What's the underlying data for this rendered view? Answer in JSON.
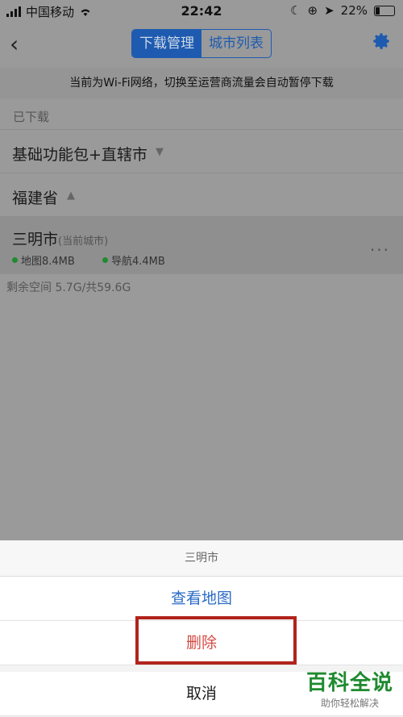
{
  "status_bar": {
    "carrier": "中国移动",
    "time": "22:42",
    "battery": "22%"
  },
  "nav": {
    "tabs": [
      {
        "label": "下载管理",
        "active": true
      },
      {
        "label": "城市列表",
        "active": false
      }
    ],
    "back_icon": "back-chevron-icon",
    "settings_icon": "gear-icon",
    "accent": "#1e5bb0"
  },
  "notice": "当前为Wi-Fi网络，切换至运营商流量会自动暂停下载",
  "downloaded": {
    "section_label": "已下载",
    "groups": [
      {
        "title": "基础功能包+直辖市",
        "expanded": false
      },
      {
        "title": "福建省",
        "expanded": true
      }
    ],
    "city": {
      "name": "三明市",
      "tag": "(当前城市)",
      "map": "地图8.4MB",
      "navigation": "导航4.4MB",
      "more": "···"
    }
  },
  "storage": "剩余空间 5.7G/共59.6G",
  "action_sheet": {
    "title": "三明市",
    "view_map": "查看地图",
    "delete": "删除",
    "cancel": "取消"
  },
  "watermark": {
    "title": "百科全说",
    "subtitle": "助你轻松解决"
  }
}
